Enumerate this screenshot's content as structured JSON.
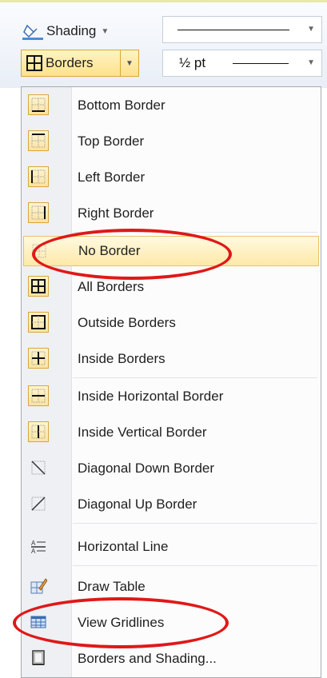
{
  "ribbon": {
    "shading_label": "Shading",
    "borders_label": "Borders",
    "line_weight": "½ pt"
  },
  "menu": {
    "items": [
      {
        "label": "Bottom Border",
        "icon": "bottom-border-icon"
      },
      {
        "label": "Top Border",
        "icon": "top-border-icon"
      },
      {
        "label": "Left Border",
        "icon": "left-border-icon"
      },
      {
        "label": "Right Border",
        "icon": "right-border-icon"
      },
      {
        "label": "No Border",
        "icon": "no-border-icon"
      },
      {
        "label": "All Borders",
        "icon": "all-borders-icon"
      },
      {
        "label": "Outside Borders",
        "icon": "outside-borders-icon"
      },
      {
        "label": "Inside Borders",
        "icon": "inside-borders-icon"
      },
      {
        "label": "Inside Horizontal Border",
        "icon": "inside-horizontal-border-icon"
      },
      {
        "label": "Inside Vertical Border",
        "icon": "inside-vertical-border-icon"
      },
      {
        "label": "Diagonal Down Border",
        "icon": "diagonal-down-border-icon"
      },
      {
        "label": "Diagonal Up Border",
        "icon": "diagonal-up-border-icon"
      },
      {
        "label": "Horizontal Line",
        "icon": "horizontal-line-icon"
      },
      {
        "label": "Draw Table",
        "icon": "draw-table-icon"
      },
      {
        "label": "View Gridlines",
        "icon": "view-gridlines-icon"
      },
      {
        "label": "Borders and Shading...",
        "icon": "borders-and-shading-icon"
      }
    ]
  },
  "colors": {
    "highlight": "#fde9a8",
    "callout": "#e01818",
    "icon_frame": "#d9a640"
  }
}
